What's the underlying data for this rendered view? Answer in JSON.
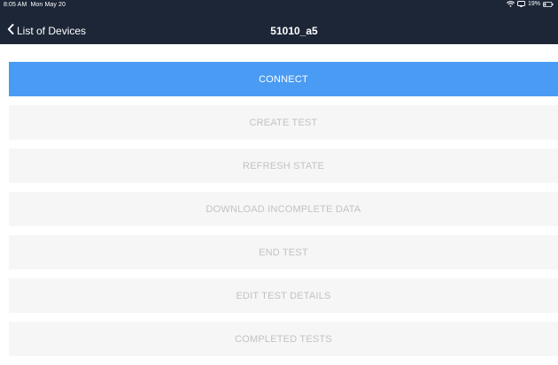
{
  "status_bar": {
    "time": "8:05 AM",
    "date": "Mon May 20",
    "battery": "19%",
    "icons": [
      "wifi-icon",
      "screen-mirroring-icon",
      "battery-icon"
    ]
  },
  "nav": {
    "back_label": "List of Devices",
    "title": "51010_a5"
  },
  "actions": [
    {
      "label": "CONNECT",
      "enabled": true
    },
    {
      "label": "CREATE TEST",
      "enabled": false
    },
    {
      "label": "REFRESH STATE",
      "enabled": false
    },
    {
      "label": "DOWNLOAD INCOMPLETE DATA",
      "enabled": false
    },
    {
      "label": "END TEST",
      "enabled": false
    },
    {
      "label": "EDIT TEST DETAILS",
      "enabled": false
    },
    {
      "label": "COMPLETED TESTS",
      "enabled": false
    }
  ],
  "colors": {
    "navbar": "#1c2637",
    "primary": "#4a9bf3",
    "disabled_bg": "#f6f6f6",
    "disabled_text": "#c2c2c2"
  }
}
